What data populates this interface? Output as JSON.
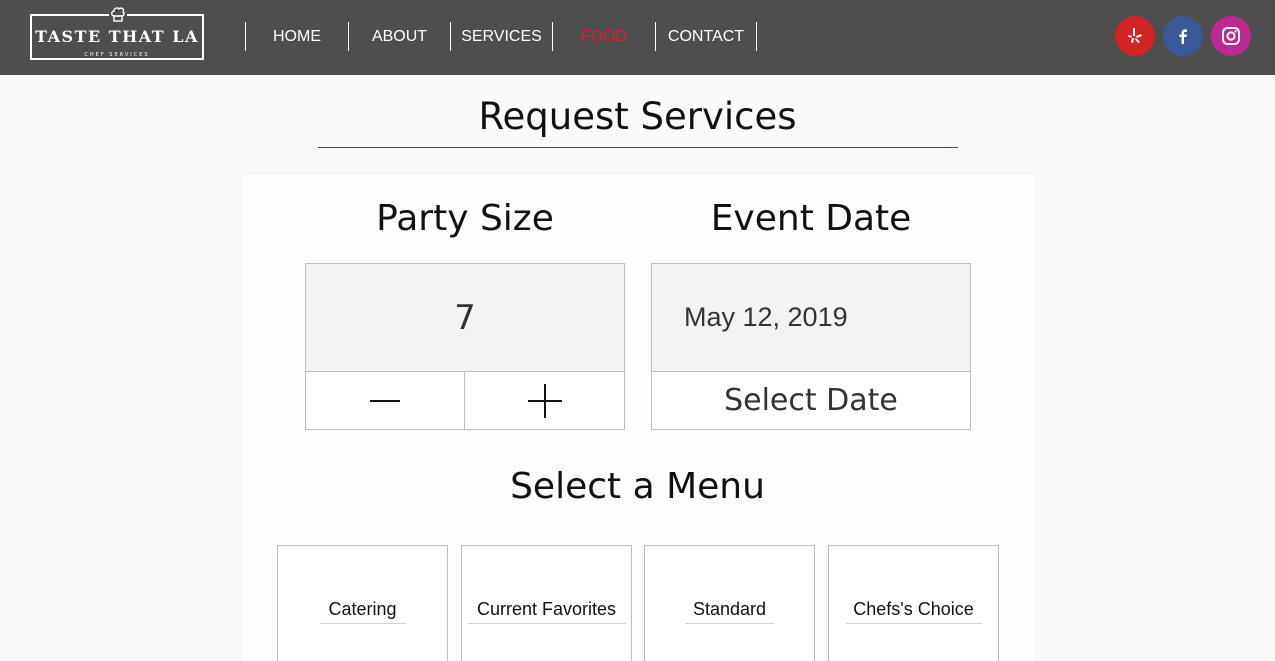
{
  "brand": {
    "name": "TASTE THAT LA",
    "tagline": "CHEF SERVICES"
  },
  "nav": {
    "items": [
      {
        "label": "HOME"
      },
      {
        "label": "ABOUT"
      },
      {
        "label": "SERVICES"
      },
      {
        "label": "FOOD",
        "active": true
      },
      {
        "label": "CONTACT"
      }
    ],
    "active_color": "#d3232f"
  },
  "social": [
    {
      "icon": "yelp-icon",
      "color": "#d32323"
    },
    {
      "icon": "facebook-icon",
      "color": "#3b5998"
    },
    {
      "icon": "instagram-icon",
      "color": "#bc2a8d"
    }
  ],
  "page": {
    "title": "Request Services"
  },
  "party": {
    "heading": "Party Size",
    "value": "7"
  },
  "event": {
    "heading": "Event Date",
    "value": "May 12, 2019",
    "select_label": "Select Date"
  },
  "menu": {
    "heading": "Select a Menu",
    "options": [
      {
        "label": "Catering"
      },
      {
        "label": "Current Favorites"
      },
      {
        "label": "Standard"
      },
      {
        "label": "Chefs's Choice"
      }
    ]
  }
}
